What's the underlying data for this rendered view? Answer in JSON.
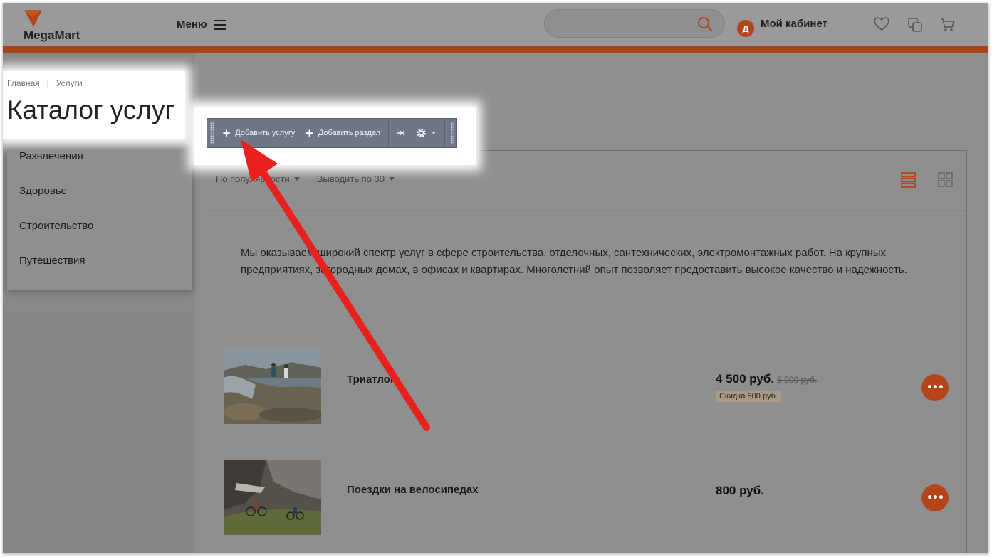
{
  "header": {
    "logo_text": "MegaMart",
    "menu_label": "Меню",
    "search": {
      "value": "",
      "placeholder": ""
    },
    "cabinet": {
      "avatar_letter": "Д",
      "label": "Мой кабинет"
    },
    "icons": [
      "heart-icon",
      "compare-icon",
      "cart-icon"
    ],
    "accent_color": "#a9441a"
  },
  "breadcrumb": {
    "home": "Главная",
    "separator": "|",
    "current": "Услуги"
  },
  "page_title": "Каталог услуг",
  "sidebar": {
    "items": [
      {
        "label": "Развлечения"
      },
      {
        "label": "Здоровье"
      },
      {
        "label": "Строительство"
      },
      {
        "label": "Путешествия"
      }
    ]
  },
  "toolbar": {
    "add_service": "Добавить услугу",
    "add_section": "Добавить раздел",
    "icons": [
      "pin-icon",
      "settings-gear-icon"
    ]
  },
  "sort": {
    "order_label": "По популярности",
    "per_page_label": "Выводить по 30"
  },
  "description": "Мы оказываем широкий спектр услуг в сфере строительства, отделочных, сантехнических, электромонтажных работ. На крупных предприятиях, загородных домах, в офисах и квартирах. Многолетний опыт позволяет предоставить высокое качество и надежность.",
  "products": [
    {
      "name": "Триатлон",
      "price": "4 500 руб.",
      "old_price": "5 000 руб.",
      "discount": "Скидка 500 руб."
    },
    {
      "name": "Поездки на велосипедах",
      "price": "800 руб.",
      "old_price": "",
      "discount": ""
    }
  ]
}
